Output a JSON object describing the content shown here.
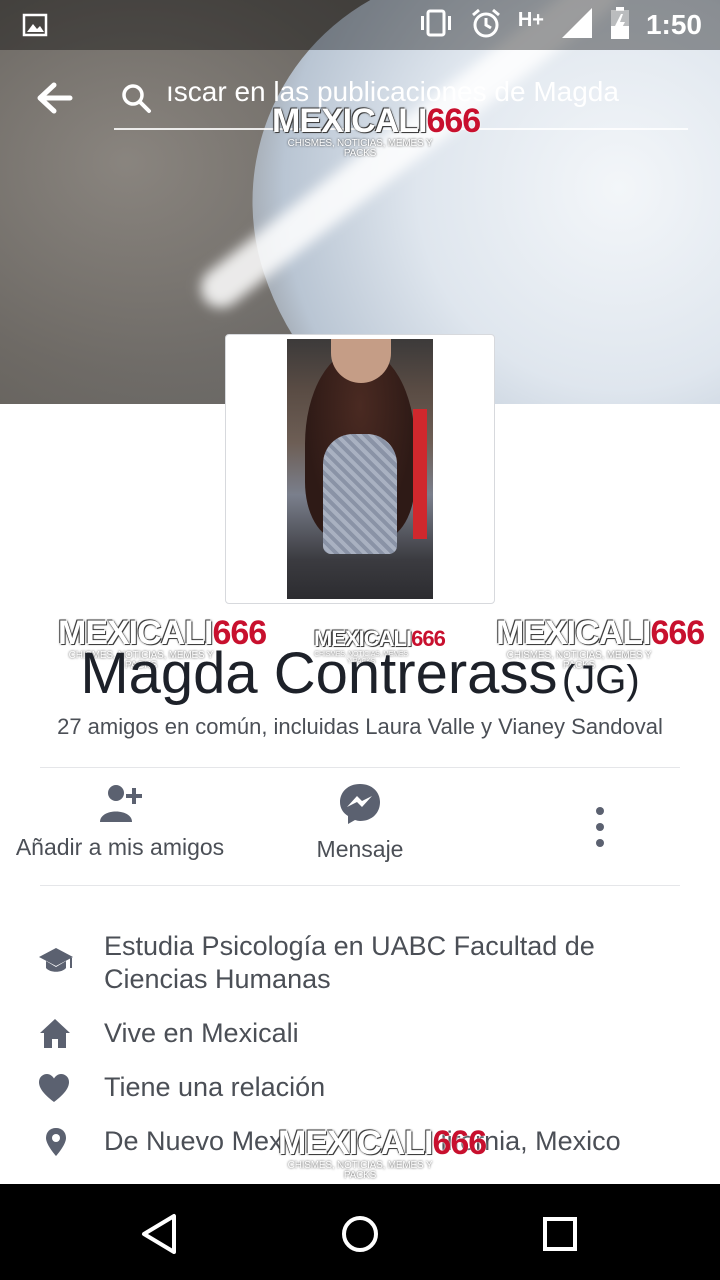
{
  "status_bar": {
    "time": "1:50",
    "network": "H+",
    "icons": [
      "image-icon",
      "vibrate-icon",
      "alarm-icon",
      "signal-icon",
      "battery-icon"
    ]
  },
  "search": {
    "value": "ıscar en las publicaciones de Magda"
  },
  "profile": {
    "name": "Magda Contrerass",
    "alternate_name": "(JG)",
    "mutual_friends": "27 amigos en común, incluidas Laura Valle y Vianey Sandoval"
  },
  "actions": {
    "add_friend": "Añadir a mis amigos",
    "message": "Mensaje"
  },
  "about": [
    {
      "icon": "graduation-cap-icon",
      "text": "Estudia Psicología en UABC Facultad de Ciencias Humanas"
    },
    {
      "icon": "home-icon",
      "text": "Vive en Mexicali"
    },
    {
      "icon": "heart-icon",
      "text": "Tiene una relación"
    },
    {
      "icon": "location-pin-icon",
      "text": "De Nuevo Mex"
    },
    {
      "icon": "",
      "text": "lifornia, Mexico"
    }
  ],
  "watermark": {
    "brand": "MEXICALI",
    "number": "666",
    "tagline": "CHISMES, NOTICIAS, MEMES Y PACKS"
  },
  "colors": {
    "text_primary": "#1d2129",
    "text_secondary": "#4b4f56",
    "icon_gray": "#5b6170",
    "watermark_red": "#c8102e"
  }
}
